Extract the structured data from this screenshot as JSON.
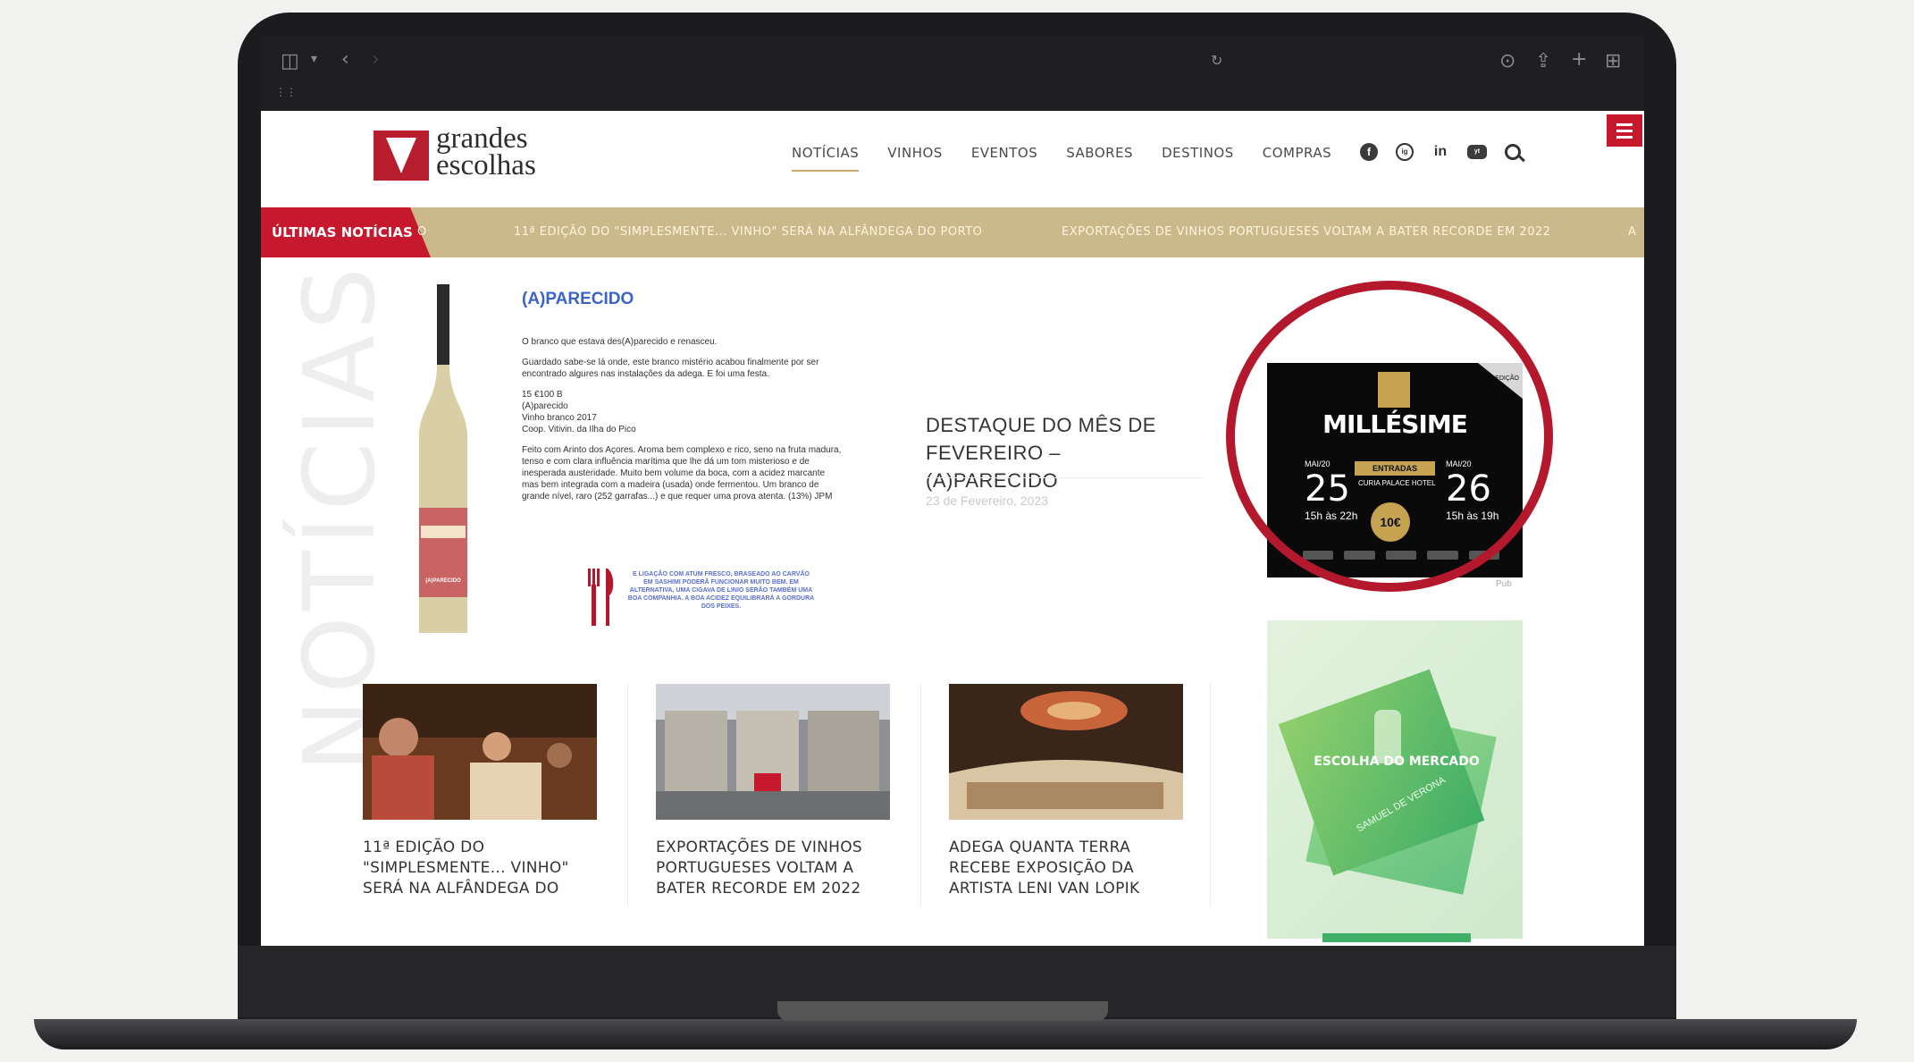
{
  "site": {
    "logo": {
      "line1": "grandes",
      "line2": "escolhas"
    },
    "nav": [
      "NOTÍCIAS",
      "VINHOS",
      "EVENTOS",
      "SABORES",
      "DESTINOS",
      "COMPRAS"
    ],
    "social": [
      "f",
      "ig",
      "in",
      "yt"
    ]
  },
  "ticker": {
    "label": "ÚLTIMAS NOTÍCIAS",
    "fragment": "O",
    "items": [
      "11ª EDIÇÃO DO \"SIMPLESMENTE... VINHO\" SERÁ NA ALFÂNDEGA DO PORTO",
      "EXPORTAÇÕES DE VINHOS PORTUGUESES VOLTAM A BATER RECORDE EM 2022"
    ],
    "tail": "A"
  },
  "section_word": "NOTÍCIAS",
  "feature": {
    "heading": "(A)PARECIDO",
    "paragraphs": [
      "O branco que estava des(A)parecido e renasceu.",
      "Guardado sabe-se lá onde, este branco mistério acabou finalmente por ser encontrado algures nas instalações da adega. E foi uma festa.",
      "15 €100 B\n(A)parecido\nVinho branco 2017\nCoop. Vitivin. da Ilha do Pico",
      "Feito com Arinto dos Açores. Aroma bem complexo e rico, seno na fruta madura, tenso e com clara influência marítima que lhe dá um tom misterioso e de inesperada austeridade. Muito bem volume da boca, com a acidez marcante mas bem integrada com a madeira (usada) onde fermentou. Um branco de grande nível, raro (252 garrafas...) e que requer uma prova atenta. (13%) JPM"
    ],
    "pairing": "E LIGAÇÃO COM ATUM FRESCO, BRASEADO AO CARVÃO EM SASHIMI PODERÃ FUNCIONAR MUITO BEM. EM ALTERNATIVA, UMA CIGAVA DE LINIO SERÃO TAMBÉM UMA BOA COMPANHIA. A BOA ACIDEZ EQUILIBRARÁ A GORDURA DOS PEIXES.",
    "bottle_label": "(A)PARECIDO"
  },
  "destaque": {
    "title": "DESTAQUE DO MÊS DE FEVEREIRO – (A)PARECIDO",
    "date": "23 de Fevereiro, 2023"
  },
  "ad_millesime": {
    "title": "MILLÉSIME",
    "tag": "ENTRADAS",
    "venue": "CURIA PALACE HOTEL",
    "day1": {
      "month": "MAI/20",
      "day": "25",
      "hours": "15h às 22h"
    },
    "day2": {
      "month": "MAI/20",
      "day": "26",
      "hours": "15h às 19h"
    },
    "price": "10€",
    "corner": "EDIÇÃO",
    "pub": "Pub"
  },
  "ad_mercado": {
    "text": "ESCOLHA DO MERCADO",
    "sub": "SAMUEL DE VERONA"
  },
  "cards": [
    {
      "title": "11ª EDIÇÃO DO \"SIMPLESMENTE... VINHO\" SERÁ NA ALFÂNDEGA DO"
    },
    {
      "title": "EXPORTAÇÕES DE VINHOS PORTUGUESES VOLTAM A BATER RECORDE EM 2022"
    },
    {
      "title": "ADEGA QUANTA TERRA RECEBE EXPOSIÇÃO DA ARTISTA LENI VAN LOPIK"
    }
  ],
  "colors": {
    "brand_red": "#c7192e",
    "ticker_gold": "#cbb98c",
    "highlight_circle": "#b3182c"
  }
}
